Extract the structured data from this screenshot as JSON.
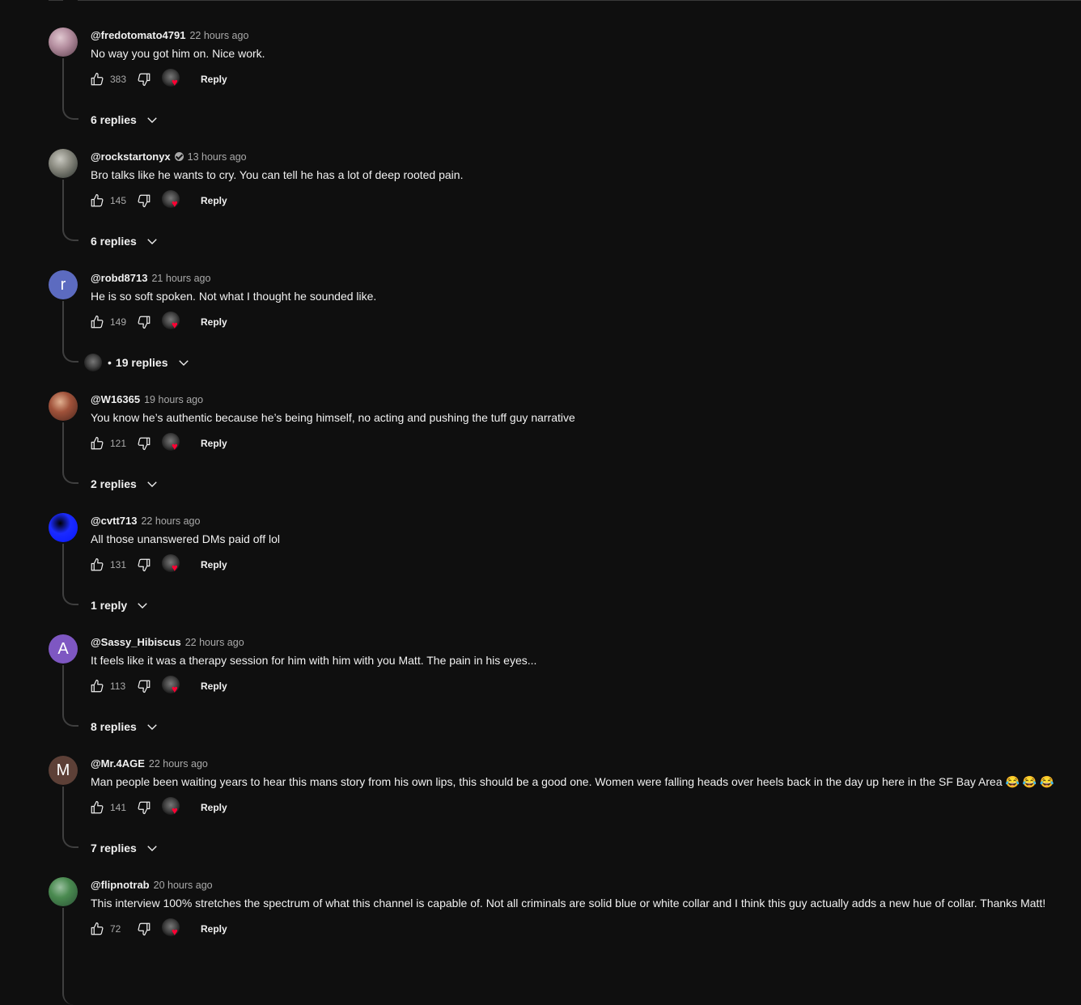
{
  "comments": [
    {
      "author": "@fredotomato4791",
      "time": "22 hours ago",
      "text": "No way you got him on. Nice work.",
      "likes": "383",
      "reply_label": "Reply",
      "replies_label": "6 replies",
      "avatar": {
        "type": "image",
        "colors": [
          "#6a4c5a",
          "#b58fa0",
          "#e0c8d0"
        ]
      },
      "verified": false,
      "creator_replied": false
    },
    {
      "author": "@rockstartonyx",
      "time": "13 hours ago",
      "text": "Bro talks like he wants to cry. You can tell he has a lot of deep rooted pain.",
      "likes": "145",
      "reply_label": "Reply",
      "replies_label": "6 replies",
      "avatar": {
        "type": "image",
        "colors": [
          "#3a3f3a",
          "#8a8a80",
          "#c8c8c0"
        ]
      },
      "verified": true,
      "creator_replied": false
    },
    {
      "author": "@robd8713",
      "time": "21 hours ago",
      "text": "He is so soft spoken. Not what I thought he sounded like.",
      "likes": "149",
      "reply_label": "Reply",
      "replies_label": "19 replies",
      "avatar": {
        "type": "letter",
        "letter": "r",
        "color": "#5c6bc0"
      },
      "verified": false,
      "creator_replied": true,
      "dot": "•"
    },
    {
      "author": "@W16365",
      "time": "19 hours ago",
      "text": "You know he’s authentic because he’s being himself, no acting and pushing the tuff guy narrative",
      "likes": "121",
      "reply_label": "Reply",
      "replies_label": "2 replies",
      "avatar": {
        "type": "image",
        "colors": [
          "#5a2e22",
          "#a0523a",
          "#e0b090"
        ]
      },
      "verified": false,
      "creator_replied": false
    },
    {
      "author": "@cvtt713",
      "time": "22 hours ago",
      "text": "All those unanswered DMs paid off lol",
      "likes": "131",
      "reply_label": "Reply",
      "replies_label": "1 reply",
      "avatar": {
        "type": "image",
        "colors": [
          "#0a1aff",
          "#1b2bff",
          "#000000"
        ]
      },
      "verified": false,
      "creator_replied": false
    },
    {
      "author": "@Sassy_Hibiscus",
      "time": "22 hours ago",
      "text": "It feels like it was a therapy session for him with him with you Matt. The pain in his eyes...",
      "likes": "113",
      "reply_label": "Reply",
      "replies_label": "8 replies",
      "avatar": {
        "type": "letter",
        "letter": "A",
        "color": "#7e57c2"
      },
      "verified": false,
      "creator_replied": false
    },
    {
      "author": "@Mr.4AGE",
      "time": "22 hours ago",
      "text": "Man people been waiting years to hear this mans story from his own lips, this should be a good one. Women were falling heads over heels back in the day up here in the SF Bay Area 😂 😂 😂",
      "likes": "141",
      "reply_label": "Reply",
      "replies_label": "7 replies",
      "avatar": {
        "type": "letter",
        "letter": "M",
        "color": "#5d4037"
      },
      "verified": false,
      "creator_replied": false
    },
    {
      "author": "@flipnotrab",
      "time": "20 hours ago",
      "text": "This interview 100% stretches the spectrum of what this channel is capable of. Not all criminals are solid blue or white collar and I think this guy actually adds a new hue of collar. Thanks Matt!",
      "likes": "72",
      "reply_label": "Reply",
      "replies_label": "",
      "avatar": {
        "type": "image",
        "colors": [
          "#2f5a3a",
          "#4a8a50",
          "#9ac0a0"
        ]
      },
      "verified": false,
      "creator_replied": false
    }
  ],
  "icons": {
    "like": "thumbs-up-icon",
    "dislike": "thumbs-down-icon",
    "creator_heart": "creator-heart-icon",
    "expand": "chevron-down-icon"
  },
  "colors": {
    "background": "#0f0f0f",
    "text": "#f1f1f1",
    "secondary_text": "#aaaaaa",
    "heart": "#ff0033"
  }
}
